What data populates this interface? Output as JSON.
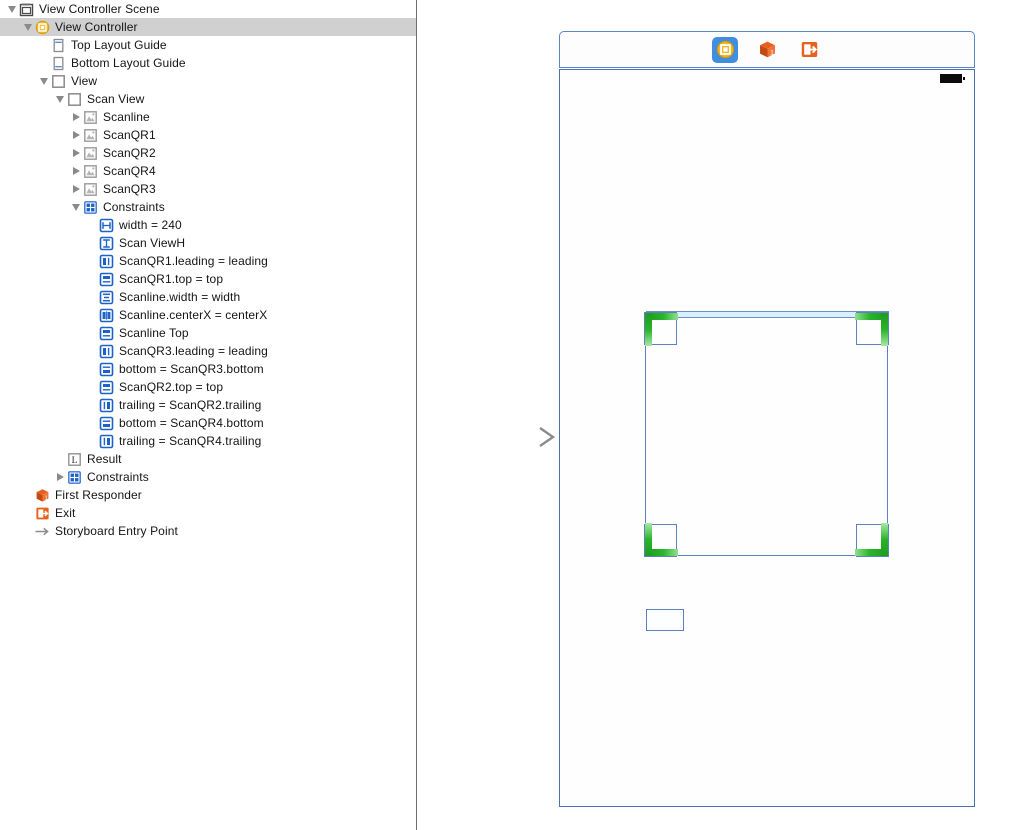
{
  "outline": {
    "rows": [
      {
        "id": "view-controller-scene",
        "label": "View Controller Scene",
        "indent": 0,
        "disclosure": "open",
        "icon": "scene-icon",
        "selected": false
      },
      {
        "id": "view-controller",
        "label": "View Controller",
        "indent": 1,
        "disclosure": "open",
        "icon": "view-controller-icon",
        "selected": true
      },
      {
        "id": "top-layout-guide",
        "label": "Top Layout Guide",
        "indent": 2,
        "disclosure": "none",
        "icon": "top-layout-guide-icon",
        "selected": false
      },
      {
        "id": "bottom-layout-guide",
        "label": "Bottom Layout Guide",
        "indent": 2,
        "disclosure": "none",
        "icon": "bottom-layout-guide-icon",
        "selected": false
      },
      {
        "id": "view",
        "label": "View",
        "indent": 2,
        "disclosure": "open",
        "icon": "view-icon",
        "selected": false
      },
      {
        "id": "scan-view",
        "label": "Scan View",
        "indent": 3,
        "disclosure": "open",
        "icon": "view-icon",
        "selected": false
      },
      {
        "id": "scanline",
        "label": "Scanline",
        "indent": 4,
        "disclosure": "closed",
        "icon": "image-view-icon",
        "selected": false
      },
      {
        "id": "scanqr1",
        "label": "ScanQR1",
        "indent": 4,
        "disclosure": "closed",
        "icon": "image-view-icon",
        "selected": false
      },
      {
        "id": "scanqr2",
        "label": "ScanQR2",
        "indent": 4,
        "disclosure": "closed",
        "icon": "image-view-icon",
        "selected": false
      },
      {
        "id": "scanqr4",
        "label": "ScanQR4",
        "indent": 4,
        "disclosure": "closed",
        "icon": "image-view-icon",
        "selected": false
      },
      {
        "id": "scanqr3",
        "label": "ScanQR3",
        "indent": 4,
        "disclosure": "closed",
        "icon": "image-view-icon",
        "selected": false
      },
      {
        "id": "constraints-scanview",
        "label": "Constraints",
        "indent": 4,
        "disclosure": "open",
        "icon": "constraints-icon",
        "selected": false
      },
      {
        "id": "c-width-240",
        "label": "width = 240",
        "indent": 5,
        "disclosure": "none",
        "icon": "constraint-width-icon",
        "selected": false
      },
      {
        "id": "c-scan-viewh",
        "label": "Scan ViewH",
        "indent": 5,
        "disclosure": "none",
        "icon": "constraint-height-icon",
        "selected": false
      },
      {
        "id": "c-qr1-leading",
        "label": "ScanQR1.leading = leading",
        "indent": 5,
        "disclosure": "none",
        "icon": "constraint-leading-icon",
        "selected": false
      },
      {
        "id": "c-qr1-top",
        "label": "ScanQR1.top = top",
        "indent": 5,
        "disclosure": "none",
        "icon": "constraint-top-icon",
        "selected": false
      },
      {
        "id": "c-scanline-width",
        "label": "Scanline.width = width",
        "indent": 5,
        "disclosure": "none",
        "icon": "constraint-equalwidth-icon",
        "selected": false
      },
      {
        "id": "c-scanline-centerx",
        "label": "Scanline.centerX = centerX",
        "indent": 5,
        "disclosure": "none",
        "icon": "constraint-centerx-icon",
        "selected": false
      },
      {
        "id": "c-scanline-top",
        "label": "Scanline Top",
        "indent": 5,
        "disclosure": "none",
        "icon": "constraint-top-icon",
        "selected": false
      },
      {
        "id": "c-qr3-leading",
        "label": "ScanQR3.leading = leading",
        "indent": 5,
        "disclosure": "none",
        "icon": "constraint-leading-icon",
        "selected": false
      },
      {
        "id": "c-bottom-qr3",
        "label": "bottom = ScanQR3.bottom",
        "indent": 5,
        "disclosure": "none",
        "icon": "constraint-bottom-icon",
        "selected": false
      },
      {
        "id": "c-qr2-top",
        "label": "ScanQR2.top = top",
        "indent": 5,
        "disclosure": "none",
        "icon": "constraint-top-icon",
        "selected": false
      },
      {
        "id": "c-trailing-qr2",
        "label": "trailing = ScanQR2.trailing",
        "indent": 5,
        "disclosure": "none",
        "icon": "constraint-trailing-icon",
        "selected": false
      },
      {
        "id": "c-bottom-qr4",
        "label": "bottom = ScanQR4.bottom",
        "indent": 5,
        "disclosure": "none",
        "icon": "constraint-bottom-icon",
        "selected": false
      },
      {
        "id": "c-trailing-qr4",
        "label": "trailing = ScanQR4.trailing",
        "indent": 5,
        "disclosure": "none",
        "icon": "constraint-trailing-icon",
        "selected": false
      },
      {
        "id": "result",
        "label": "Result",
        "indent": 3,
        "disclosure": "none",
        "icon": "label-icon",
        "selected": false
      },
      {
        "id": "constraints-view",
        "label": "Constraints",
        "indent": 3,
        "disclosure": "closed",
        "icon": "constraints-icon",
        "selected": false
      },
      {
        "id": "first-responder",
        "label": "First Responder",
        "indent": 1,
        "disclosure": "none",
        "icon": "first-responder-icon",
        "selected": false
      },
      {
        "id": "exit",
        "label": "Exit",
        "indent": 1,
        "disclosure": "none",
        "icon": "exit-icon",
        "selected": false
      },
      {
        "id": "storyboard-entry-point",
        "label": "Storyboard Entry Point",
        "indent": 1,
        "disclosure": "none",
        "icon": "entry-point-arrow-icon",
        "selected": false
      }
    ]
  },
  "canvas": {
    "dock": {
      "items": [
        {
          "id": "dock-view-controller",
          "name": "view-controller-icon",
          "selected": true
        },
        {
          "id": "dock-first-responder",
          "name": "first-responder-icon",
          "selected": false
        },
        {
          "id": "dock-exit",
          "name": "exit-icon",
          "selected": false
        }
      ]
    },
    "status_bar": {
      "battery": "battery-icon"
    },
    "scan_view": {
      "name": "Scan View",
      "scanline": "Scanline",
      "corners": [
        {
          "id": "scanqr1",
          "label": "ScanQR1",
          "position": "top-left"
        },
        {
          "id": "scanqr2",
          "label": "ScanQR2",
          "position": "top-right"
        },
        {
          "id": "scanqr3",
          "label": "ScanQR3",
          "position": "bottom-left"
        },
        {
          "id": "scanqr4",
          "label": "ScanQR4",
          "position": "bottom-right"
        }
      ]
    },
    "result_label": {
      "name": "Result",
      "text": ""
    },
    "entry_point": "Storyboard Entry Point"
  },
  "colors": {
    "selection_row": "#d0d0d0",
    "canvas_outline": "#4a6fb0",
    "view_outline": "#5f7fc0",
    "corner_green": "#28b428",
    "scanline_fill": "#d9f0fd",
    "dock_selected": "#3f8ee0",
    "constraint_blue": "#1d62c9",
    "accent_orange": "#e8601d",
    "vc_yellow": "#f5b720"
  }
}
